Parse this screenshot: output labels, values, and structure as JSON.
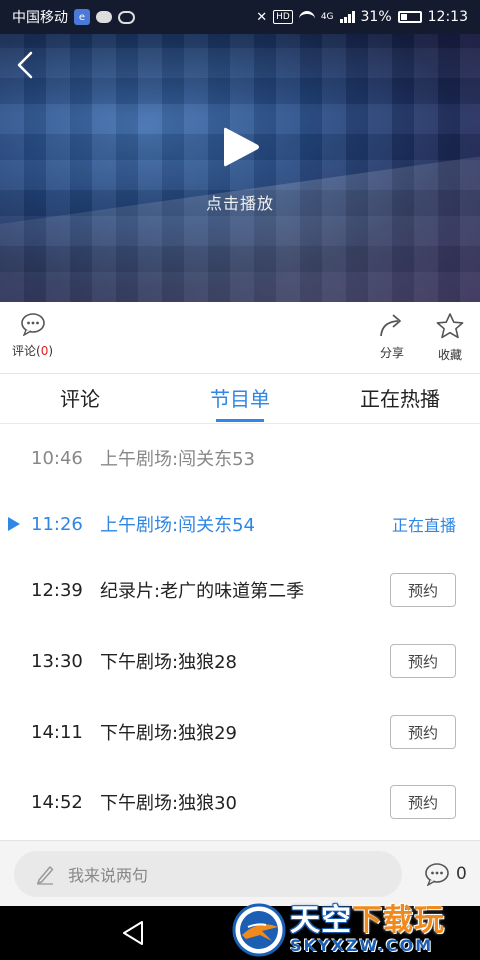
{
  "status_bar": {
    "carrier": "中国移动",
    "network": "4G",
    "battery": "31%",
    "time": "12:13"
  },
  "video": {
    "play_label": "点击播放"
  },
  "actions": {
    "comment_label": "评论",
    "comment_open": "(",
    "comment_count": "0",
    "comment_close": ")",
    "share_label": "分享",
    "favorite_label": "收藏"
  },
  "tabs": [
    {
      "label": "评论",
      "active": false
    },
    {
      "label": "节目单",
      "active": true
    },
    {
      "label": "正在热播",
      "active": false
    }
  ],
  "programs": [
    {
      "time": "10:46",
      "title": "上午剧场:闯关东53",
      "state": "past"
    },
    {
      "time": "11:26",
      "title": "上午剧场:闯关东54",
      "state": "live",
      "status": "正在直播"
    },
    {
      "time": "12:39",
      "title": "纪录片:老广的味道第二季",
      "state": "upcoming",
      "action": "预约"
    },
    {
      "time": "13:30",
      "title": "下午剧场:独狼28",
      "state": "upcoming",
      "action": "预约"
    },
    {
      "time": "14:11",
      "title": "下午剧场:独狼29",
      "state": "upcoming",
      "action": "预约"
    },
    {
      "time": "14:52",
      "title": "下午剧场:独狼30",
      "state": "upcoming",
      "action": "预约"
    }
  ],
  "comment_bar": {
    "placeholder": "我来说两句",
    "count": "0"
  },
  "watermark": {
    "text_a": "天空",
    "text_b": "下载玩",
    "url": "SKYXZW.COM"
  },
  "colors": {
    "accent": "#2f86e4",
    "alert": "#e02020",
    "status_bar": "#141b2e"
  }
}
